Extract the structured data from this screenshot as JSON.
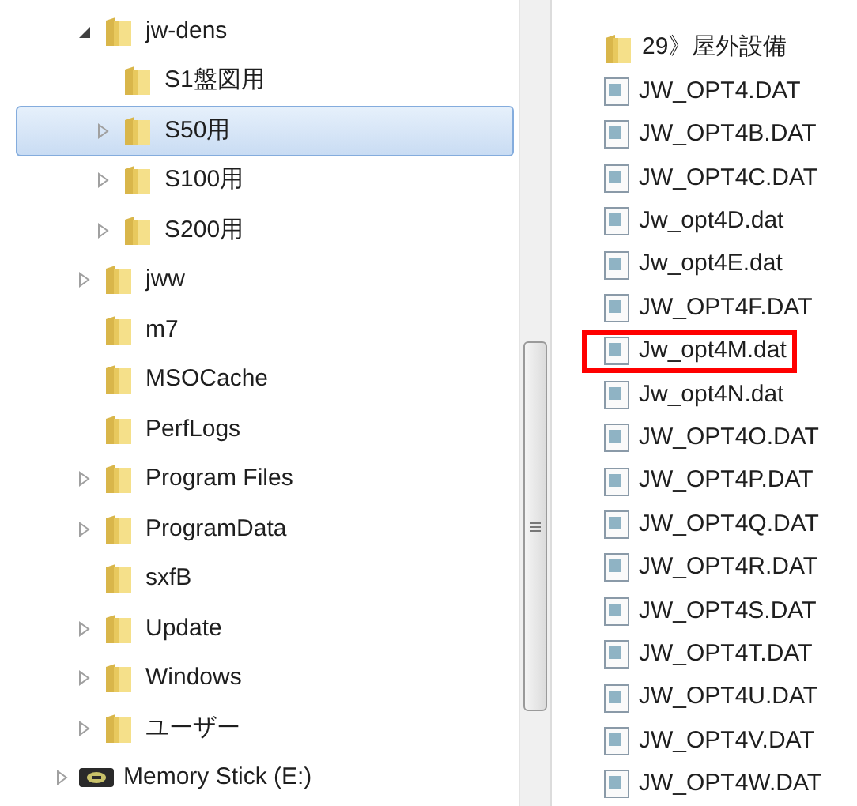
{
  "tree": [
    {
      "label": "jw-dens",
      "expandable": true,
      "expanded": true,
      "selected": false,
      "children": [
        {
          "label": "S1盤図用",
          "expandable": false,
          "selected": false
        },
        {
          "label": "S50用",
          "expandable": true,
          "expanded": false,
          "selected": true
        },
        {
          "label": "S100用",
          "expandable": true,
          "expanded": false,
          "selected": false
        },
        {
          "label": "S200用",
          "expandable": true,
          "expanded": false,
          "selected": false
        }
      ]
    },
    {
      "label": "jww",
      "expandable": true,
      "expanded": false,
      "selected": false
    },
    {
      "label": "m7",
      "expandable": false,
      "selected": false
    },
    {
      "label": "MSOCache",
      "expandable": false,
      "selected": false
    },
    {
      "label": "PerfLogs",
      "expandable": false,
      "selected": false
    },
    {
      "label": "Program Files",
      "expandable": true,
      "expanded": false,
      "selected": false
    },
    {
      "label": "ProgramData",
      "expandable": true,
      "expanded": false,
      "selected": false
    },
    {
      "label": "sxfB",
      "expandable": false,
      "selected": false
    },
    {
      "label": "Update",
      "expandable": true,
      "expanded": false,
      "selected": false
    },
    {
      "label": "Windows",
      "expandable": true,
      "expanded": false,
      "selected": false
    },
    {
      "label": "ユーザー",
      "expandable": true,
      "expanded": false,
      "selected": false
    }
  ],
  "drives": [
    {
      "label": "Memory Stick (E:)",
      "expandable": true,
      "expanded": false,
      "selected": false
    }
  ],
  "files": [
    {
      "name": "29》屋外設備",
      "kind": "folder",
      "marked": false
    },
    {
      "name": "JW_OPT4.DAT",
      "kind": "file",
      "marked": false
    },
    {
      "name": "JW_OPT4B.DAT",
      "kind": "file",
      "marked": false
    },
    {
      "name": "JW_OPT4C.DAT",
      "kind": "file",
      "marked": false
    },
    {
      "name": "Jw_opt4D.dat",
      "kind": "file",
      "marked": false
    },
    {
      "name": "Jw_opt4E.dat",
      "kind": "file",
      "marked": false
    },
    {
      "name": "JW_OPT4F.DAT",
      "kind": "file",
      "marked": false
    },
    {
      "name": "Jw_opt4M.dat",
      "kind": "file",
      "marked": true
    },
    {
      "name": "Jw_opt4N.dat",
      "kind": "file",
      "marked": false
    },
    {
      "name": "JW_OPT4O.DAT",
      "kind": "file",
      "marked": false
    },
    {
      "name": "JW_OPT4P.DAT",
      "kind": "file",
      "marked": false
    },
    {
      "name": "JW_OPT4Q.DAT",
      "kind": "file",
      "marked": false
    },
    {
      "name": "JW_OPT4R.DAT",
      "kind": "file",
      "marked": false
    },
    {
      "name": "JW_OPT4S.DAT",
      "kind": "file",
      "marked": false
    },
    {
      "name": "JW_OPT4T.DAT",
      "kind": "file",
      "marked": false
    },
    {
      "name": "JW_OPT4U.DAT",
      "kind": "file",
      "marked": false
    },
    {
      "name": "JW_OPT4V.DAT",
      "kind": "file",
      "marked": false
    },
    {
      "name": "JW_OPT4W.DAT",
      "kind": "file",
      "marked": false
    }
  ]
}
